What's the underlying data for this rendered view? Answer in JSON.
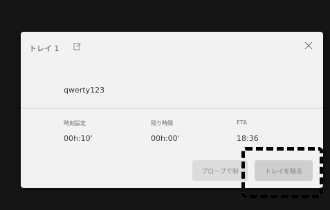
{
  "dialog": {
    "title": "トレイ 1",
    "name": "qwerty123"
  },
  "fields": [
    {
      "label": "時刻設定",
      "value": "00h:10'"
    },
    {
      "label": "残り時間",
      "value": "00h:00'"
    },
    {
      "label": "ETA",
      "value": "18:36"
    }
  ],
  "buttons": {
    "probe": "プローブで制",
    "remove": "トレイを除去"
  },
  "icons": {
    "edit": "edit-icon",
    "close": "close-icon"
  },
  "colors": {
    "dialog_bg": "#f2f2f2",
    "overlay_bg": "#151515"
  }
}
